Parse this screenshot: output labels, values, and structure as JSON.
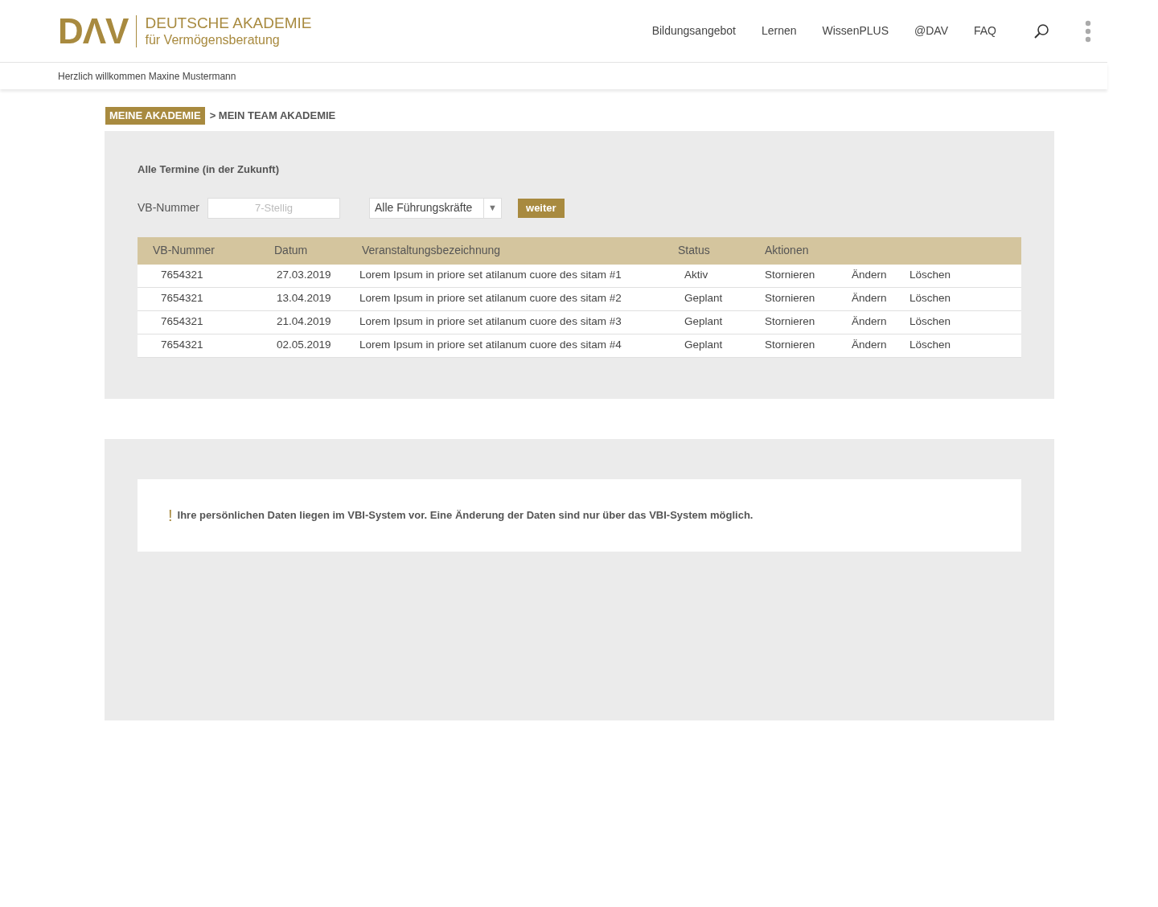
{
  "logo": {
    "mark": "DΛV",
    "line_1": "DEUTSCHE AKADEMIE",
    "line_2": "für Vermögensberatung"
  },
  "nav": [
    "Bildungsangebot",
    "Lernen",
    "WissenPLUS",
    "@DAV",
    "FAQ"
  ],
  "welcome": "Herzlich willkommen Maxine Mustermann",
  "breadcrumb": {
    "current": "MEINE AKADEMIE",
    "next": "> MEIN TEAM AKADEMIE"
  },
  "panel": {
    "title": "Alle Termine (in der Zukunft)",
    "vb_label": "VB-Nummer",
    "vb_field": {
      "placeholder": "7-Stellig"
    },
    "select": {
      "value": "Alle Führungskräfte",
      "arrow": "▼"
    },
    "button": "weiter"
  },
  "table": {
    "columns": [
      "VB-Nummer",
      "Datum",
      "Veranstaltungsbezeichnung",
      "Status",
      "Aktionen"
    ],
    "rows": [
      {
        "vb": "7654321",
        "datum": "27.03.2019",
        "title": "Lorem Ipsum in priore set atilanum cuore des sitam #1",
        "status": "Aktiv",
        "actions": [
          "Stornieren",
          "Ändern",
          "Löschen"
        ]
      },
      {
        "vb": "7654321",
        "datum": "13.04.2019",
        "title": "Lorem Ipsum in priore set atilanum cuore des sitam #2",
        "status": "Geplant",
        "actions": [
          "Stornieren",
          "Ändern",
          "Löschen"
        ]
      },
      {
        "vb": "7654321",
        "datum": "21.04.2019",
        "title": "Lorem Ipsum in priore set atilanum cuore des sitam #3",
        "status": "Geplant",
        "actions": [
          "Stornieren",
          "Ändern",
          "Löschen"
        ]
      },
      {
        "vb": "7654321",
        "datum": "02.05.2019",
        "title": "Lorem Ipsum in priore set atilanum cuore des sitam #4",
        "status": "Geplant",
        "actions": [
          "Stornieren",
          "Ändern",
          "Löschen"
        ]
      }
    ]
  },
  "notice": {
    "mark": "!",
    "text": "Ihre persönlichen Daten liegen im VBI-System vor. Eine Änderung der Daten sind nur über das VBI-System möglich."
  }
}
